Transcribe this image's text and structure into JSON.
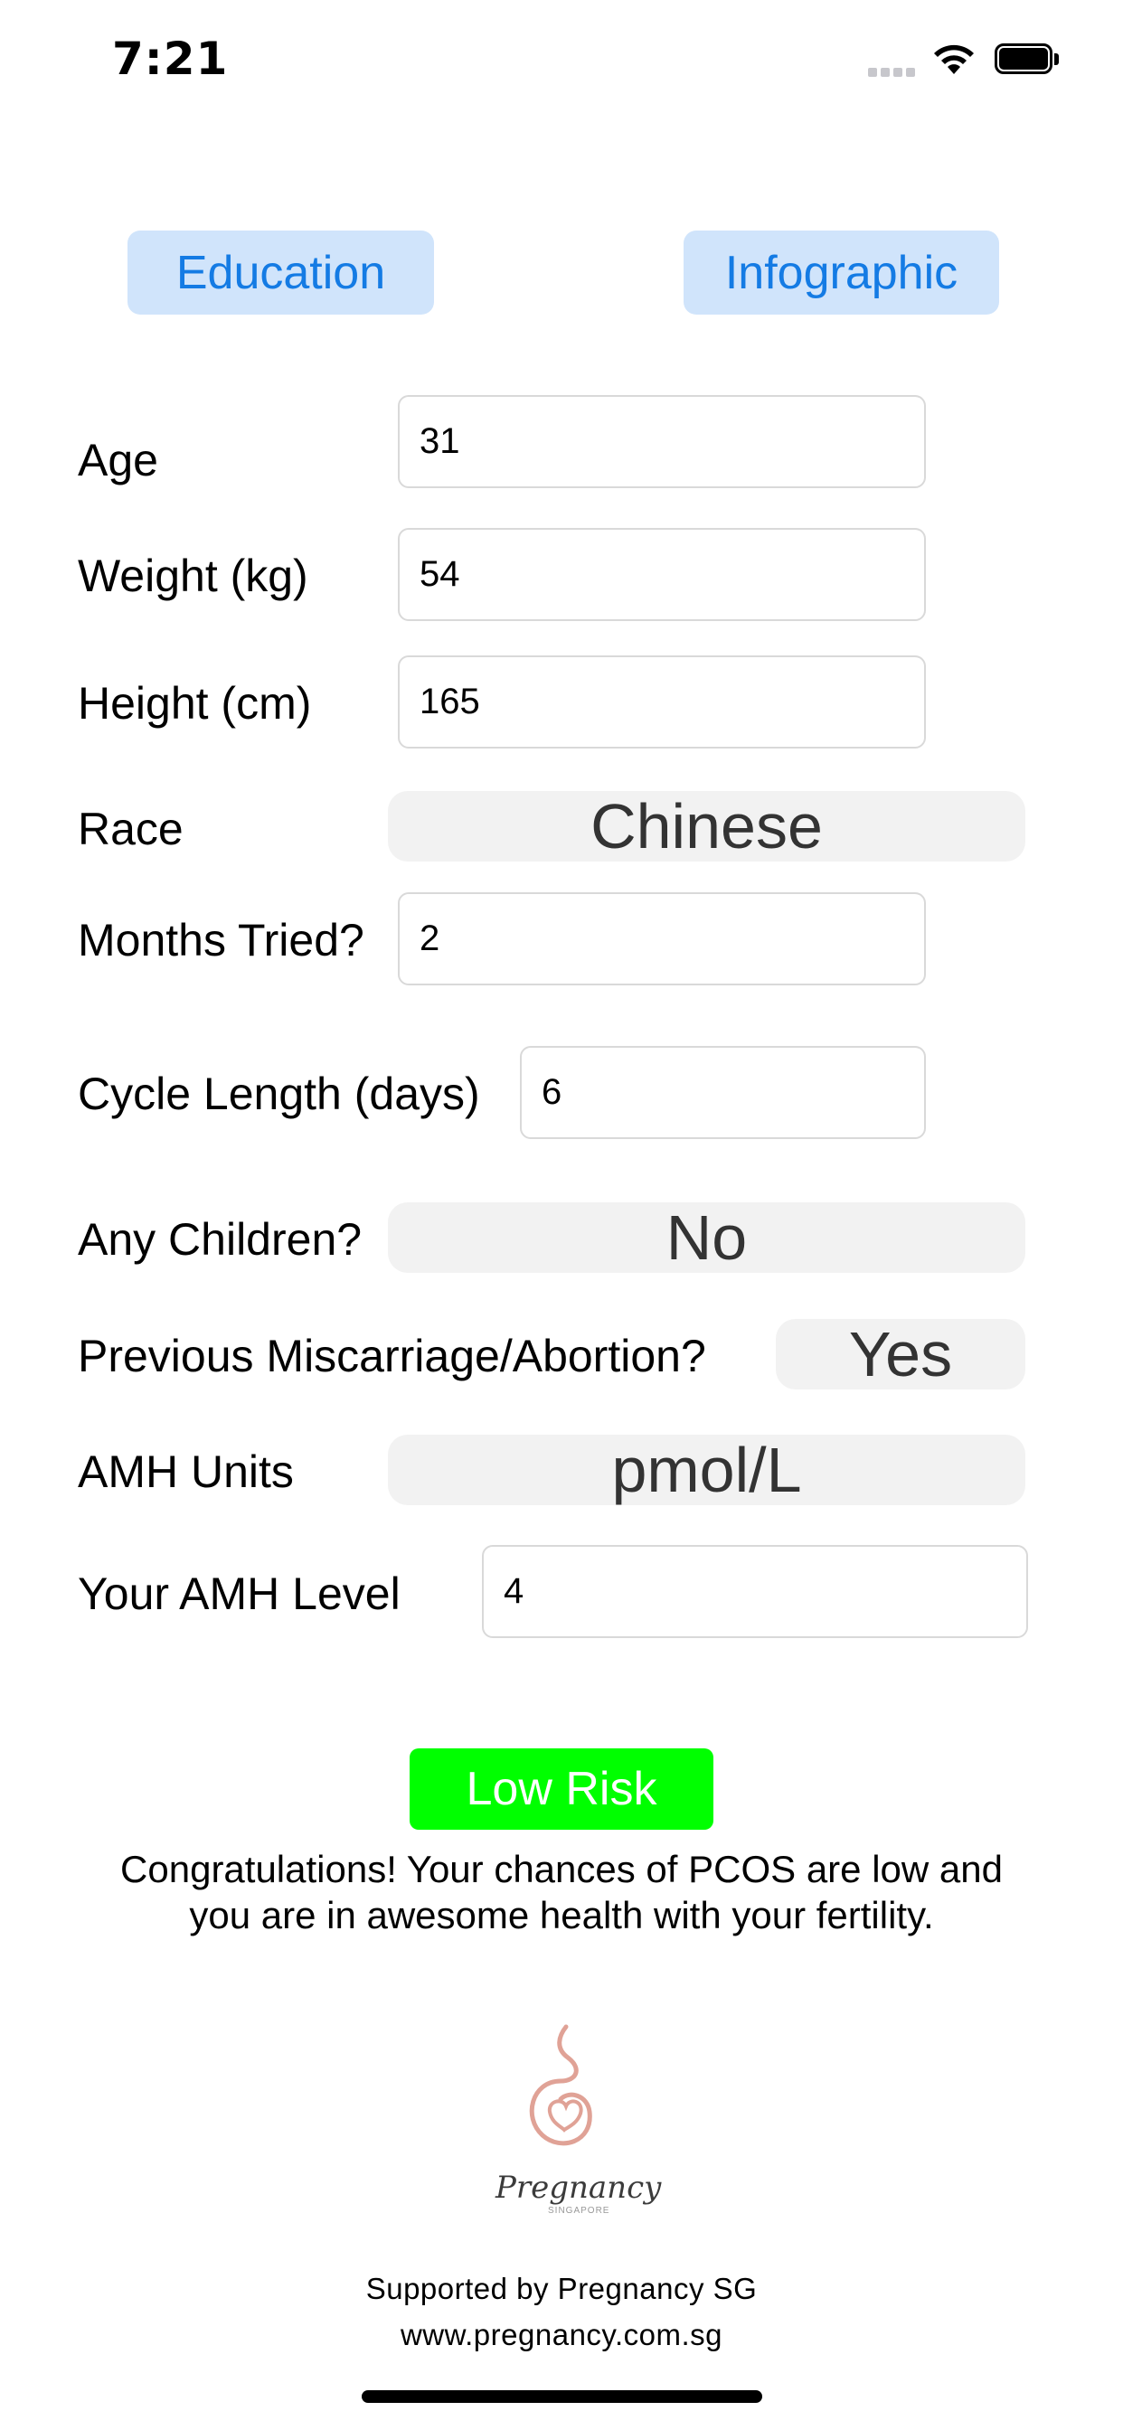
{
  "status_bar": {
    "time": "7:21"
  },
  "nav": {
    "education_label": "Education",
    "infographic_label": "Infographic"
  },
  "form": {
    "age": {
      "label": "Age",
      "value": "31"
    },
    "weight": {
      "label": "Weight (kg)",
      "value": "54"
    },
    "height": {
      "label": "Height (cm)",
      "value": "165"
    },
    "race": {
      "label": "Race",
      "value": "Chinese"
    },
    "months_tried": {
      "label": "Months Tried?",
      "value": "2"
    },
    "cycle_length": {
      "label": "Cycle Length (days)",
      "value": "6"
    },
    "any_children": {
      "label": "Any Children?",
      "value": "No"
    },
    "miscarriage": {
      "label": "Previous Miscarriage/Abortion?",
      "value": "Yes"
    },
    "amh_units": {
      "label": "AMH Units",
      "value": "pmol/L"
    },
    "amh_level": {
      "label": "Your AMH Level",
      "value": "4"
    }
  },
  "result": {
    "risk_label": "Low Risk",
    "risk_color": "#00ff00",
    "message": "Congratulations! Your chances of PCOS are low and you are in awesome health with your fertility."
  },
  "logo": {
    "wordmark": "Pregnancy",
    "subtext": "SINGAPORE"
  },
  "footer": {
    "supported_by": "Supported by Pregnancy SG",
    "website": "www.pregnancy.com.sg"
  },
  "colors": {
    "accent": "#147be4",
    "accent_bg": "#d0e4fb",
    "select_bg": "#f2f2f2",
    "logo": "#e0a296"
  }
}
